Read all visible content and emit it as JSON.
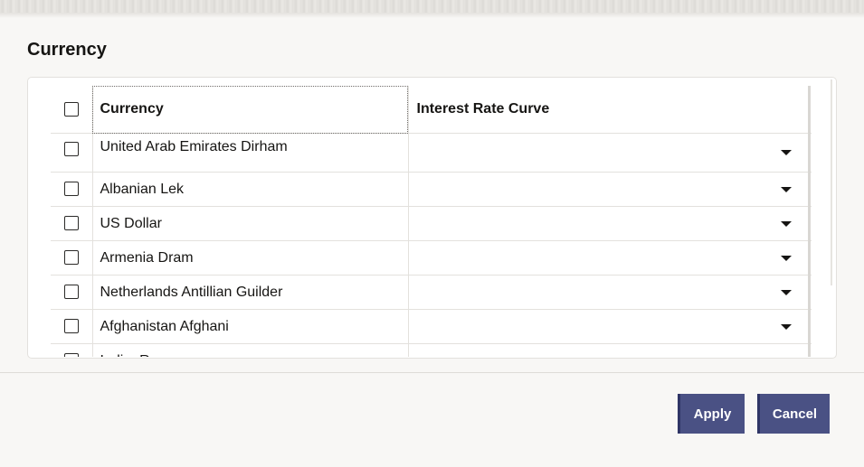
{
  "dialog": {
    "title": "Currency"
  },
  "table": {
    "columns": {
      "currency": "Currency",
      "interest_rate_curve": "Interest Rate Curve"
    },
    "rows": [
      {
        "currency": "United Arab Emirates Dirham",
        "interest_rate_curve": ""
      },
      {
        "currency": "Albanian Lek",
        "interest_rate_curve": ""
      },
      {
        "currency": "US Dollar",
        "interest_rate_curve": ""
      },
      {
        "currency": "Armenia Dram",
        "interest_rate_curve": ""
      },
      {
        "currency": "Netherlands Antillian Guilder",
        "interest_rate_curve": ""
      },
      {
        "currency": "Afghanistan Afghani",
        "interest_rate_curve": ""
      },
      {
        "currency": "IndianRupee",
        "interest_rate_curve": ""
      }
    ]
  },
  "footer": {
    "apply_label": "Apply",
    "cancel_label": "Cancel"
  },
  "colors": {
    "button_bg": "#4a5184",
    "background": "#f8f7f5",
    "text": "#161513"
  },
  "icons": {
    "dropdown": "chevron-down-icon",
    "checkbox": "checkbox-icon"
  }
}
